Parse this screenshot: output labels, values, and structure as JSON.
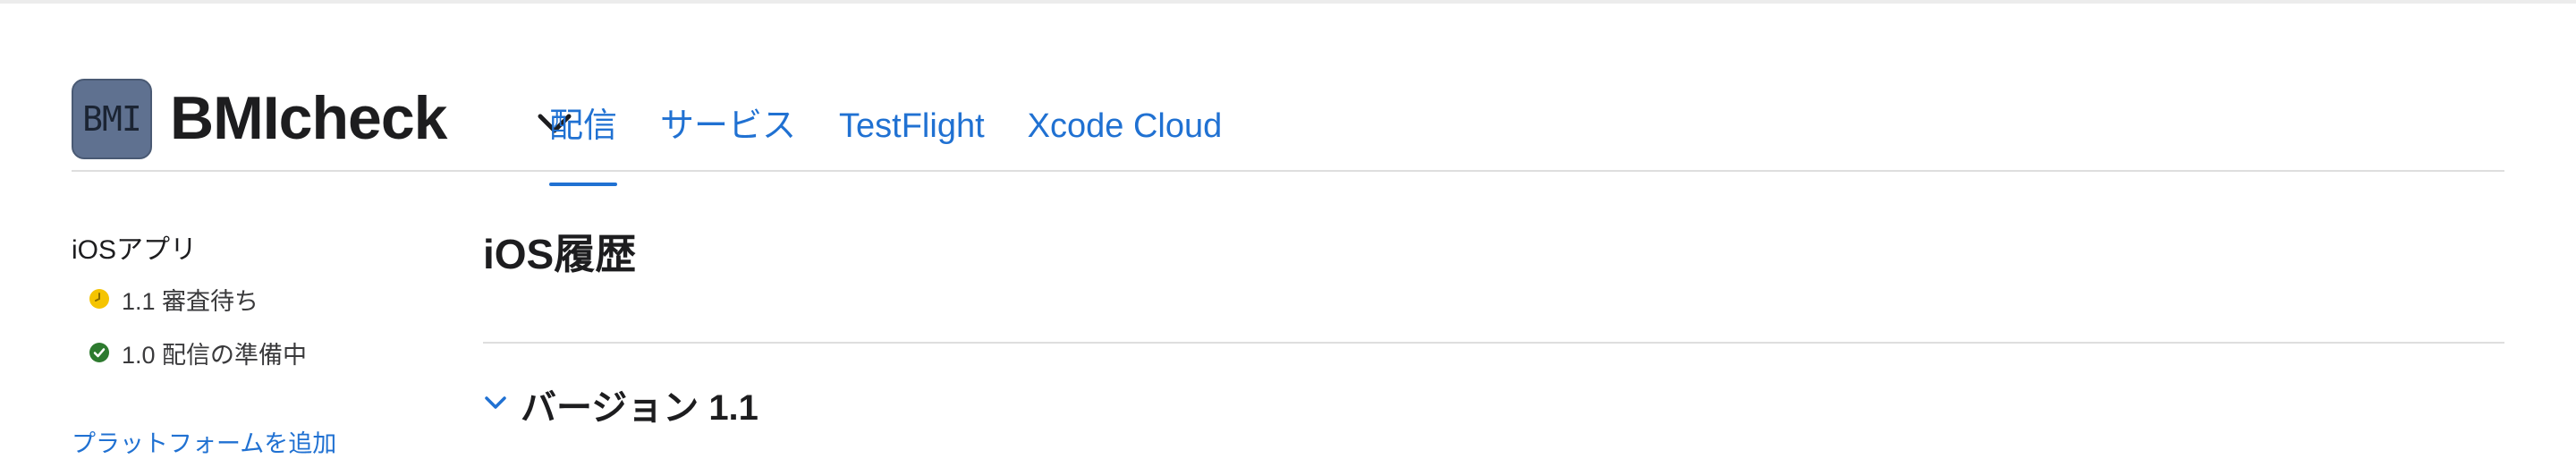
{
  "app": {
    "icon_text": "BMI",
    "name": "BMIcheck"
  },
  "tabs": [
    {
      "label": "配信",
      "active": true
    },
    {
      "label": "サービス",
      "active": false
    },
    {
      "label": "TestFlight",
      "active": false
    },
    {
      "label": "Xcode Cloud",
      "active": false
    }
  ],
  "sidebar": {
    "heading": "iOSアプリ",
    "items": [
      {
        "label": "1.1 審査待ち",
        "status_icon": "clock-icon",
        "status_color": "#f5c400"
      },
      {
        "label": "1.0 配信の準備中",
        "status_icon": "checkmark-circle-icon",
        "status_color": "#2d7a2f"
      }
    ],
    "add_platform": "プラットフォームを追加"
  },
  "main": {
    "title": "iOS履歴",
    "version_title": "バージョン 1.1"
  },
  "colors": {
    "accent": "#2071d2",
    "icon_bg": "#5f7190"
  }
}
